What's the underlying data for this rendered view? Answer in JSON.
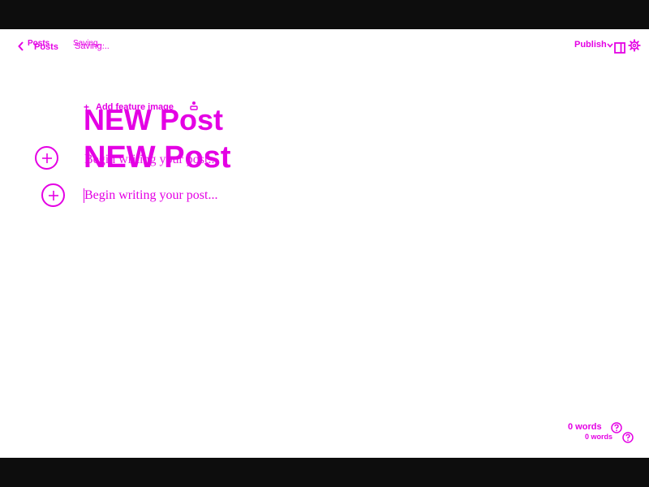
{
  "header": {
    "back_label": "Posts",
    "back_label_dup": "Posts",
    "status": "Saving...",
    "status_dup": "Saving...",
    "publish_label": "Publish"
  },
  "editor": {
    "feature_image_label": "Add feature image",
    "title": "NEW Post",
    "title_dup": "NEW Post",
    "body_placeholder": "Begin writing your post...",
    "body_placeholder_dup": "Begin writing your post..."
  },
  "footer": {
    "word_count": "0 words",
    "word_count_dup": "0 words"
  },
  "colors": {
    "accent": "#e400e4",
    "letterbox": "#0d0d0d",
    "canvas": "#ffffff"
  },
  "icons": [
    "chevron-left-icon",
    "chevron-down-icon",
    "sidebar-toggle-icon",
    "gear-icon",
    "plus-icon",
    "help-icon",
    "user-icon"
  ]
}
